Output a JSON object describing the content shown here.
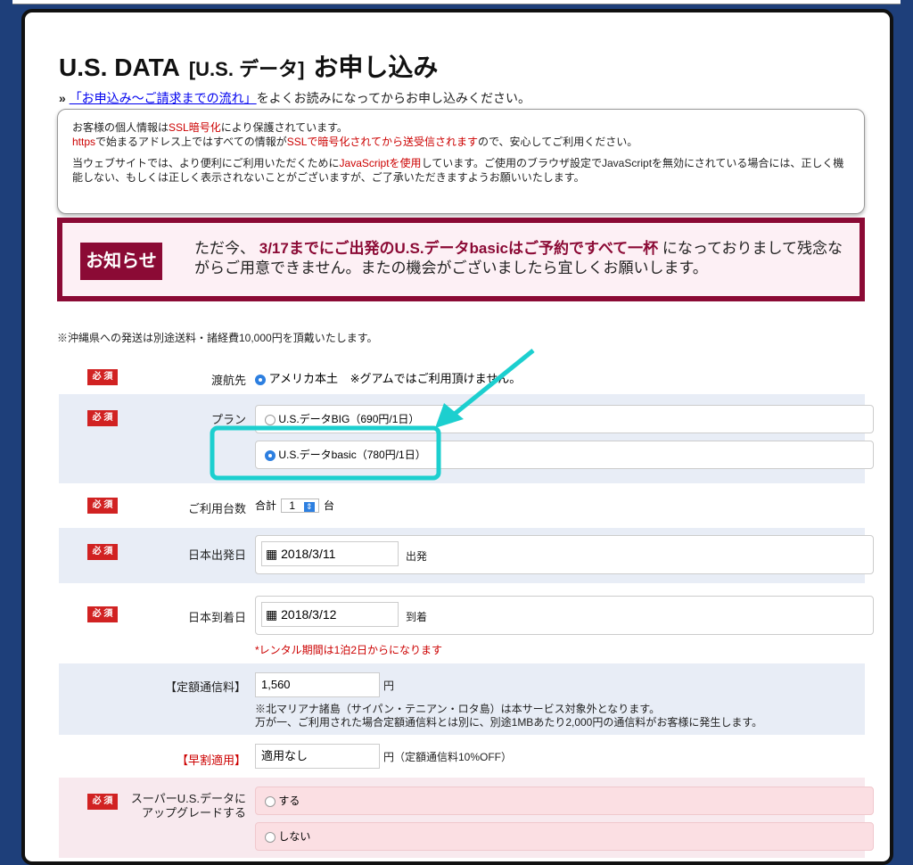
{
  "header": {
    "title_main": "U.S. DATA",
    "title_bracket": "[U.S. データ]",
    "title_action": "お申し込み",
    "sub_prefix": "»",
    "sub_link": "「お申込み〜ご請求までの流れ」",
    "sub_rest": "をよくお読みになってからお申し込みください。"
  },
  "info": {
    "l1a": "お客様の個人情報は",
    "l1b": "SSL暗号化",
    "l1c": "により保護されています。",
    "l2a": "https",
    "l2b": "で始まるアドレス上ではすべての情報が",
    "l2c": "SSLで暗号化されてから送受信されます",
    "l2d": "ので、安心してご利用ください。",
    "l3a": "当ウェブサイトでは、より便利にご利用いただくために",
    "l3b": "JavaScriptを使用",
    "l3c": "しています。ご使用のブラウザ設定でJavaScriptを無効にされている場合には、正しく機能しない、もしくは正しく表示されないことがございますが、ご了承いただきますようお願いいたします。"
  },
  "notice": {
    "badge": "お知らせ",
    "t1": "ただ今、",
    "t2": "3/17までにご出発のU.S.データbasicはご予約ですべて一杯",
    "t3": "になっておりまして残念ながらご用意できません。またの機会がございましたら宜しくお願いします。"
  },
  "okinawa_note": "※沖縄県への発送は別途送料・諸経費10,000円を頂戴いたします。",
  "required_label": "必 須",
  "form": {
    "destination": {
      "label": "渡航先",
      "option": "アメリカ本土",
      "note": "※グアムではご利用頂けません。"
    },
    "plan": {
      "label": "プラン",
      "options": [
        "U.S.データBIG（690円/1日）",
        "U.S.データbasic（780円/1日）"
      ],
      "selected": 1
    },
    "units": {
      "label": "ご利用台数",
      "prefix": "合計",
      "value": "1",
      "suffix": "台"
    },
    "departure": {
      "label": "日本出発日",
      "value": "2018/3/11",
      "suffix": "出発"
    },
    "arrival": {
      "label": "日本到着日",
      "value": "2018/3/12",
      "suffix": "到着",
      "note": "*レンタル期間は1泊2日からになります"
    },
    "fee": {
      "label": "【定額通信料】",
      "value": "1,560",
      "suffix": "円",
      "note1": "※北マリアナ諸島（サイパン・テニアン・ロタ島）は本サービス対象外となります。",
      "note2": "万が一、ご利用された場合定額通信料とは別に、別途1MBあたり2,000円の通信料がお客様に発生します。"
    },
    "early": {
      "label": "【早割適用】",
      "value": "適用なし",
      "suffix": "円（定額通信料10%OFF）"
    },
    "upgrade": {
      "label1": "スーパーU.S.データに",
      "label2": "アップグレードする",
      "options": [
        "する",
        "しない"
      ]
    }
  },
  "colors": {
    "accent": "#8b0a35",
    "highlight": "#1ccfcf",
    "required": "#d12222"
  }
}
